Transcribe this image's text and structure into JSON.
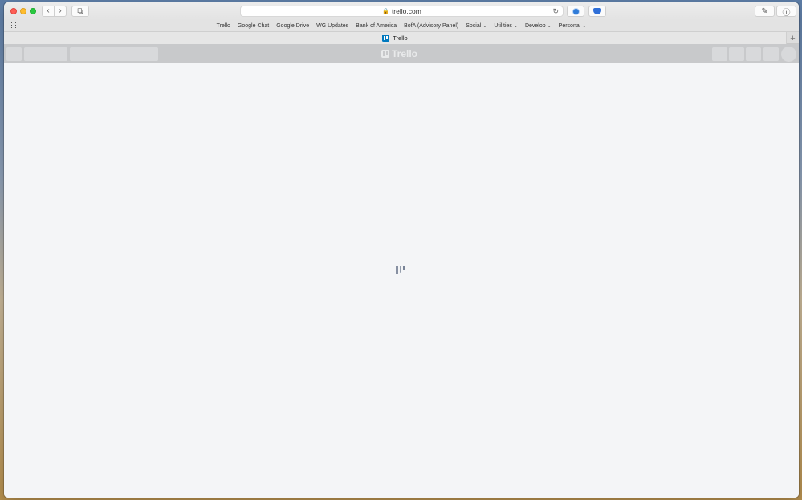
{
  "browser": {
    "url": "trello.com",
    "nav_back": "‹",
    "nav_forward": "›",
    "tabs_overview": "⧉",
    "reload": "↻",
    "lock": "🔒",
    "sidebar": "✎",
    "info": "ⓘ"
  },
  "favorites": {
    "items": [
      {
        "label": "Trello"
      },
      {
        "label": "Google Chat"
      },
      {
        "label": "Google Drive"
      },
      {
        "label": "WG Updates"
      },
      {
        "label": "Bank of America"
      },
      {
        "label": "BofA (Advisory Panel)"
      },
      {
        "label": "Social",
        "chev": "⌄"
      },
      {
        "label": "Utilities",
        "chev": "⌄"
      },
      {
        "label": "Develop",
        "chev": "⌄"
      },
      {
        "label": "Personal",
        "chev": "⌄"
      }
    ]
  },
  "tab": {
    "title": "Trello",
    "new_tab": "+"
  },
  "trello": {
    "logo_text": "Trello"
  }
}
